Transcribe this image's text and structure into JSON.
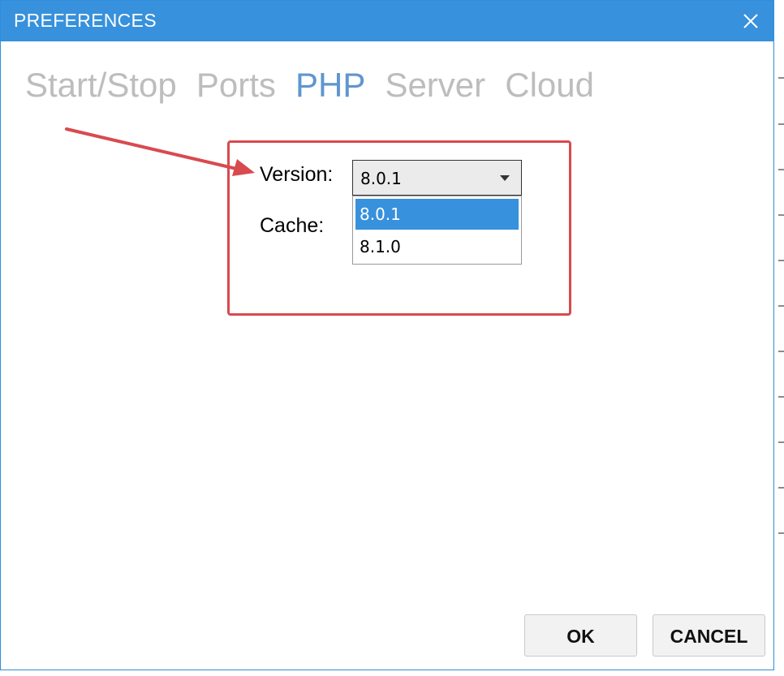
{
  "window": {
    "title": "PREFERENCES"
  },
  "tabs": [
    {
      "label": "Start/Stop",
      "active": false
    },
    {
      "label": "Ports",
      "active": false
    },
    {
      "label": "PHP",
      "active": true
    },
    {
      "label": "Server",
      "active": false
    },
    {
      "label": "Cloud",
      "active": false
    }
  ],
  "php": {
    "version_label": "Version:",
    "cache_label": "Cache:",
    "version_value": "8.0.1",
    "version_options": [
      "8.0.1",
      "8.1.0"
    ],
    "selected_option": "8.0.1"
  },
  "buttons": {
    "ok": "OK",
    "cancel": "CANCEL"
  },
  "colors": {
    "titlebar": "#3791dc",
    "active_tab": "#5f96cf",
    "inactive_tab": "#bdbdbd",
    "annotation": "#d84a4f",
    "selection": "#3791dc"
  }
}
